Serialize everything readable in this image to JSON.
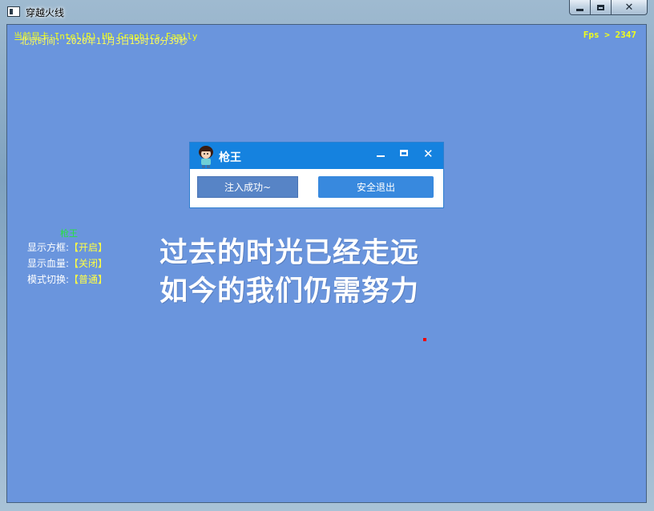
{
  "window": {
    "title": "穿越火线"
  },
  "hud": {
    "gpu_text": "当前显卡:Intel(R) HD Graphics Family",
    "time_text": "北京时间: 2020年11月3日15时10分39秒",
    "fps_text": "Fps > 2347"
  },
  "cheat_menu": {
    "title": "枪王",
    "items": [
      {
        "label": "显示方框:",
        "value": "【开启】"
      },
      {
        "label": "显示血量:",
        "value": "【关闭】"
      },
      {
        "label": "模式切换:",
        "value": "【普通】"
      }
    ]
  },
  "poem": {
    "line1": "过去的时光已经走远",
    "line2": "如今的我们仍需努力"
  },
  "dialog": {
    "title": "枪王",
    "inject_button": "注入成功~",
    "exit_button": "安全退出"
  },
  "colors": {
    "game_bg": "#6a95dd",
    "dialog_header": "#1582df",
    "hud_yellow": "#f1ff1a",
    "menu_green": "#27e33e"
  }
}
